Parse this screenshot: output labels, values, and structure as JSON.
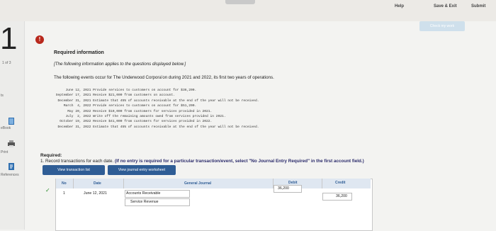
{
  "topbar": {
    "help": "Help",
    "save_exit": "Save & Exit",
    "submit": "Submit",
    "check_work": "Check my work"
  },
  "left": {
    "question_number": "1",
    "of_text": "1 of 3",
    "nav_items": [
      "ts",
      "eBook",
      "Print",
      "References"
    ]
  },
  "required_info": {
    "title": "Required information",
    "note": "[The following information applies to the questions displayed below.]",
    "intro": "The following events occur for The Underwood Corpora’on during 2021 and 2022, its first two years of operations."
  },
  "events": [
    "      June 12, 2021 Provide services to customers on account for $36,200.",
    " September 17, 2021 Receive $21,000 from customers on account.",
    "  December 31, 2021 Estimate that 45% of accounts receivable at the end of the year will not be received.",
    "     March  4, 2022 Provide services to customers on account for $51,200.",
    "       May 20, 2022 Receive $10,000 from customers for services provided in 2021.",
    "      July  2, 2022 Write off the remaining amounts owed from services provided in 2021.",
    "   October 19, 2022 Receive $41,000 from customers for services provided in 2022.",
    "  December 31, 2022 Estimate that 45% of accounts receivable at the end of the year will not be received."
  ],
  "required": {
    "label": "Required:",
    "text": "1. Record transactions for each date.",
    "bold_text": "(If no entry is required for a particular transaction/event, select \"No Journal Entry Required\" in the first account field.)"
  },
  "tabs": {
    "view_list": "View transaction list",
    "view_worksheet": "View journal entry worksheet"
  },
  "table": {
    "headers": {
      "no": "No",
      "date": "Date",
      "general_journal": "General Journal",
      "debit": "Debit",
      "credit": "Credit"
    },
    "rows": [
      {
        "no": "1",
        "date": "June 12, 2021",
        "account1": "Accounts Receivable",
        "debit": "36,200",
        "account2": "Service Revenue",
        "credit": "36,200"
      }
    ]
  }
}
